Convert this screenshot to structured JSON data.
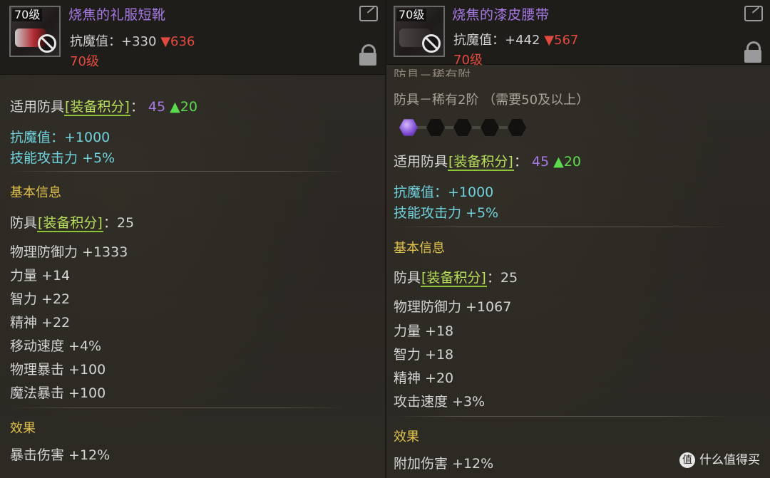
{
  "left": {
    "badge": "70级",
    "name": "烧焦的礼服短靴",
    "resist_label": "抗魔值：",
    "resist_value": "+330",
    "resist_drop": "▼636",
    "level_text": "70级",
    "applicable_label": "适用防具",
    "score_tag": "[装备积分]",
    "colon": "：",
    "score_value": "45",
    "score_delta": "▲20",
    "bonus1": "抗魔值：+1000",
    "bonus2": "技能攻击力 +5%",
    "basic_info": "基本信息",
    "armor_label": "防具",
    "armor_score": "25",
    "stats": [
      "物理防御力 +1333",
      "力量 +14",
      "智力 +22",
      "精神 +22",
      "移动速度 +4%",
      "物理暴击 +100",
      "魔法暴击 +100"
    ],
    "effect_title": "效果",
    "effect_value": "暴击伤害 +12%"
  },
  "right": {
    "badge": "70级",
    "name": "烧焦的漆皮腰带",
    "resist_label": "抗魔值：",
    "resist_value": "+442",
    "resist_drop": "▼567",
    "level_text": "70级",
    "cut_line": "防具－稀有附",
    "armor_rarity": "防具－稀有2阶 （需要50及以上）",
    "applicable_label": "适用防具",
    "score_tag": "[装备积分]",
    "colon": "：",
    "score_value": "45",
    "score_delta": "▲20",
    "bonus1": "抗魔值：+1000",
    "bonus2": "技能攻击力 +5%",
    "basic_info": "基本信息",
    "armor_label": "防具",
    "armor_score": "25",
    "stats": [
      "物理防御力 +1067",
      "力量 +18",
      "智力 +18",
      "精神 +20",
      "攻击速度 +3%"
    ],
    "effect_title": "效果",
    "effect_value": "附加伤害 +12%"
  },
  "watermark": "什么值得买",
  "watermark_icon": "值",
  "colors": {
    "item_name": "#a679e6",
    "red": "#e24a40",
    "cyan": "#6fd2dd",
    "section": "#e1c24d",
    "green": "#5ddb4e"
  }
}
